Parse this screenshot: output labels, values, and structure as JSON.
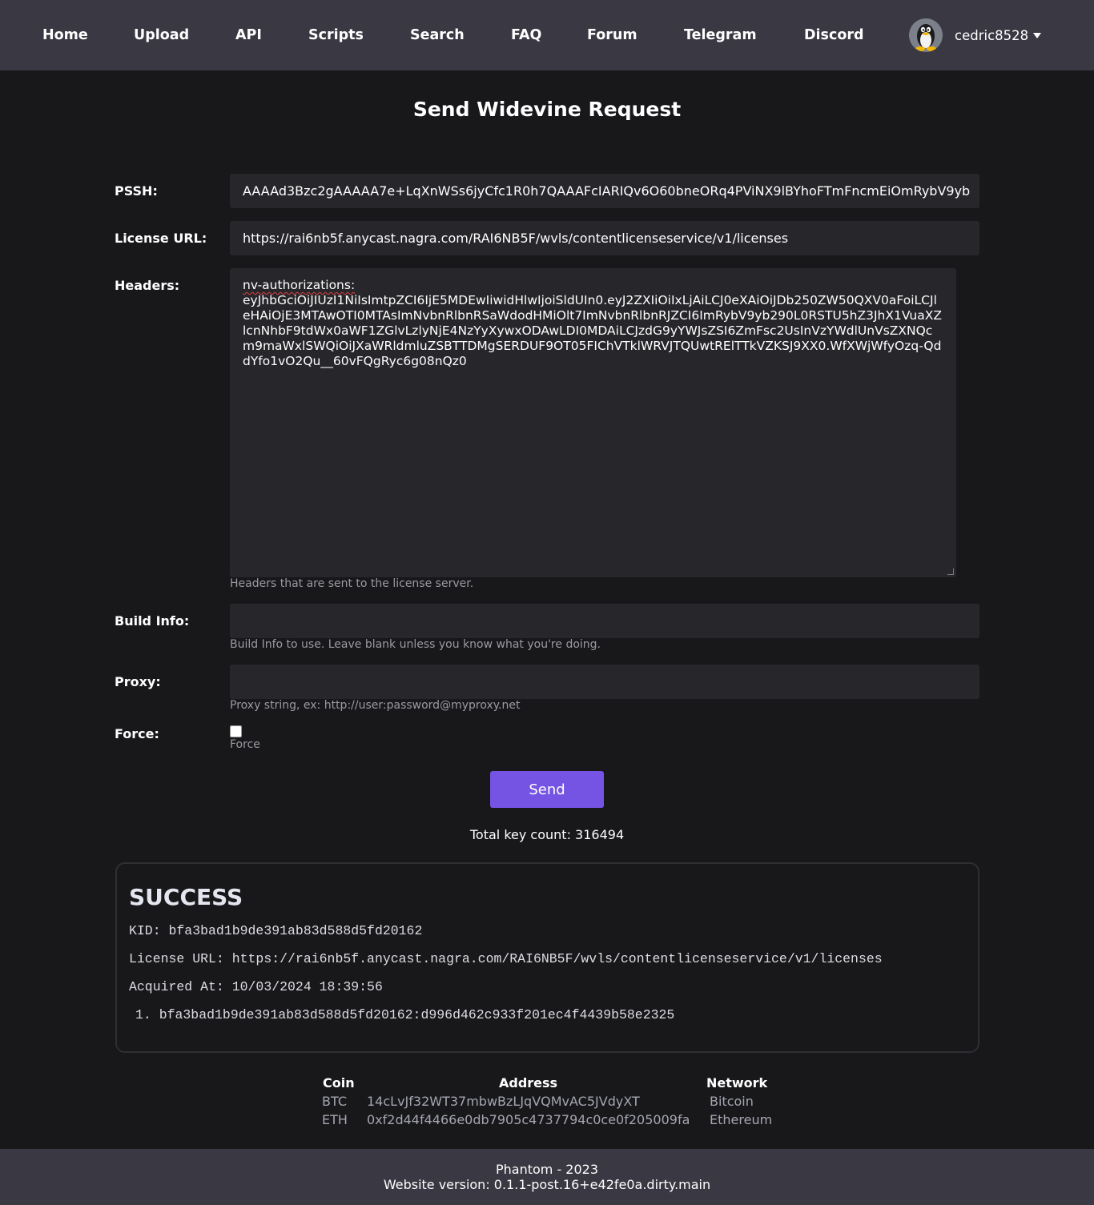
{
  "nav": {
    "items": [
      "Home",
      "Upload",
      "API",
      "Scripts",
      "Search",
      "FAQ",
      "Forum",
      "Telegram",
      "Discord"
    ],
    "username": "cedric8528"
  },
  "page_title": "Send Widevine Request",
  "form": {
    "pssh_label": "PSSH:",
    "pssh_value": "AAAAd3Bzc2gAAAAA7e+LqXnWSs6jyCfc1R0h7QAAAFcIARIQv6O60bneORq4PViNX9lBYhoFTmFncmEiOmRybV9yb",
    "license_label": "License URL:",
    "license_value": "https://rai6nb5f.anycast.nagra.com/RAI6NB5F/wvls/contentlicenseservice/v1/licenses",
    "headers_label": "Headers:",
    "headers_value_line1": "nv-authorizations:",
    "headers_value_rest": "eyJhbGciOiJIUzI1NiIsImtpZCI6IjE5MDEwIiwidHlwIjoiSldUIn0.eyJ2ZXIiOiIxLjAiLCJ0eXAiOiJDb250ZW50QXV0aFoiLCJleHAiOjE3MTAwOTI0MTAsImNvbnRlbnRSaWdodHMiOlt7ImNvbnRlbnRJZCI6ImRybV9yb290L0RSTU5hZ3JhX1VuaXZlcnNhbF9tdWx0aWF1ZGlvLzlyNjE4NzYyXywxODAwLDI0MDAiLCJzdG9yYWJsZSI6ZmFsc2UsInVzYWdlUnVsZXNQcm9maWxlSWQiOiJXaWRldmluZSBTTDMgSERDUF9OT05FIChVTklWRVJTQUwtRElTTkVZKSJ9XX0.WfXWjWfyOzq-QddYfo1vO2Qu__60vFQgRyc6g08nQz0",
    "headers_help": "Headers that are sent to the license server.",
    "build_label": "Build Info:",
    "build_value": "",
    "build_help": "Build Info to use. Leave blank unless you know what you're doing.",
    "proxy_label": "Proxy:",
    "proxy_value": "",
    "proxy_help": "Proxy string, ex: http://user:password@myproxy.net",
    "force_label": "Force:",
    "force_help": "Force",
    "send_label": "Send"
  },
  "total_key_count": "Total key count: 316494",
  "result": {
    "status": "SUCCESS",
    "kid": "KID: bfa3bad1b9de391ab83d588d5fd20162",
    "license_url": "License URL: https://rai6nb5f.anycast.nagra.com/RAI6NB5F/wvls/contentlicenseservice/v1/licenses",
    "acquired_at": "Acquired At: 10/03/2024 18:39:56",
    "keys": [
      "1. bfa3bad1b9de391ab83d588d5fd20162:d996d462c933f201ec4f4439b58e2325"
    ]
  },
  "donations": {
    "headers": [
      "Coin",
      "Address",
      "Network"
    ],
    "rows": [
      [
        "BTC",
        "14cLvJf32WT37mbwBzLJqVQMvAC5JVdyXT",
        "Bitcoin"
      ],
      [
        "ETH",
        "0xf2d44f4466e0db7905c4737794c0ce0f205009fa",
        "Ethereum"
      ]
    ]
  },
  "footer": {
    "line1": "Phantom - 2023",
    "line2": "Website version: 0.1.1-post.16+e42fe0a.dirty.main"
  },
  "colors": {
    "navbar": "#393843",
    "background": "#18181b",
    "accent": "#7554e3"
  }
}
